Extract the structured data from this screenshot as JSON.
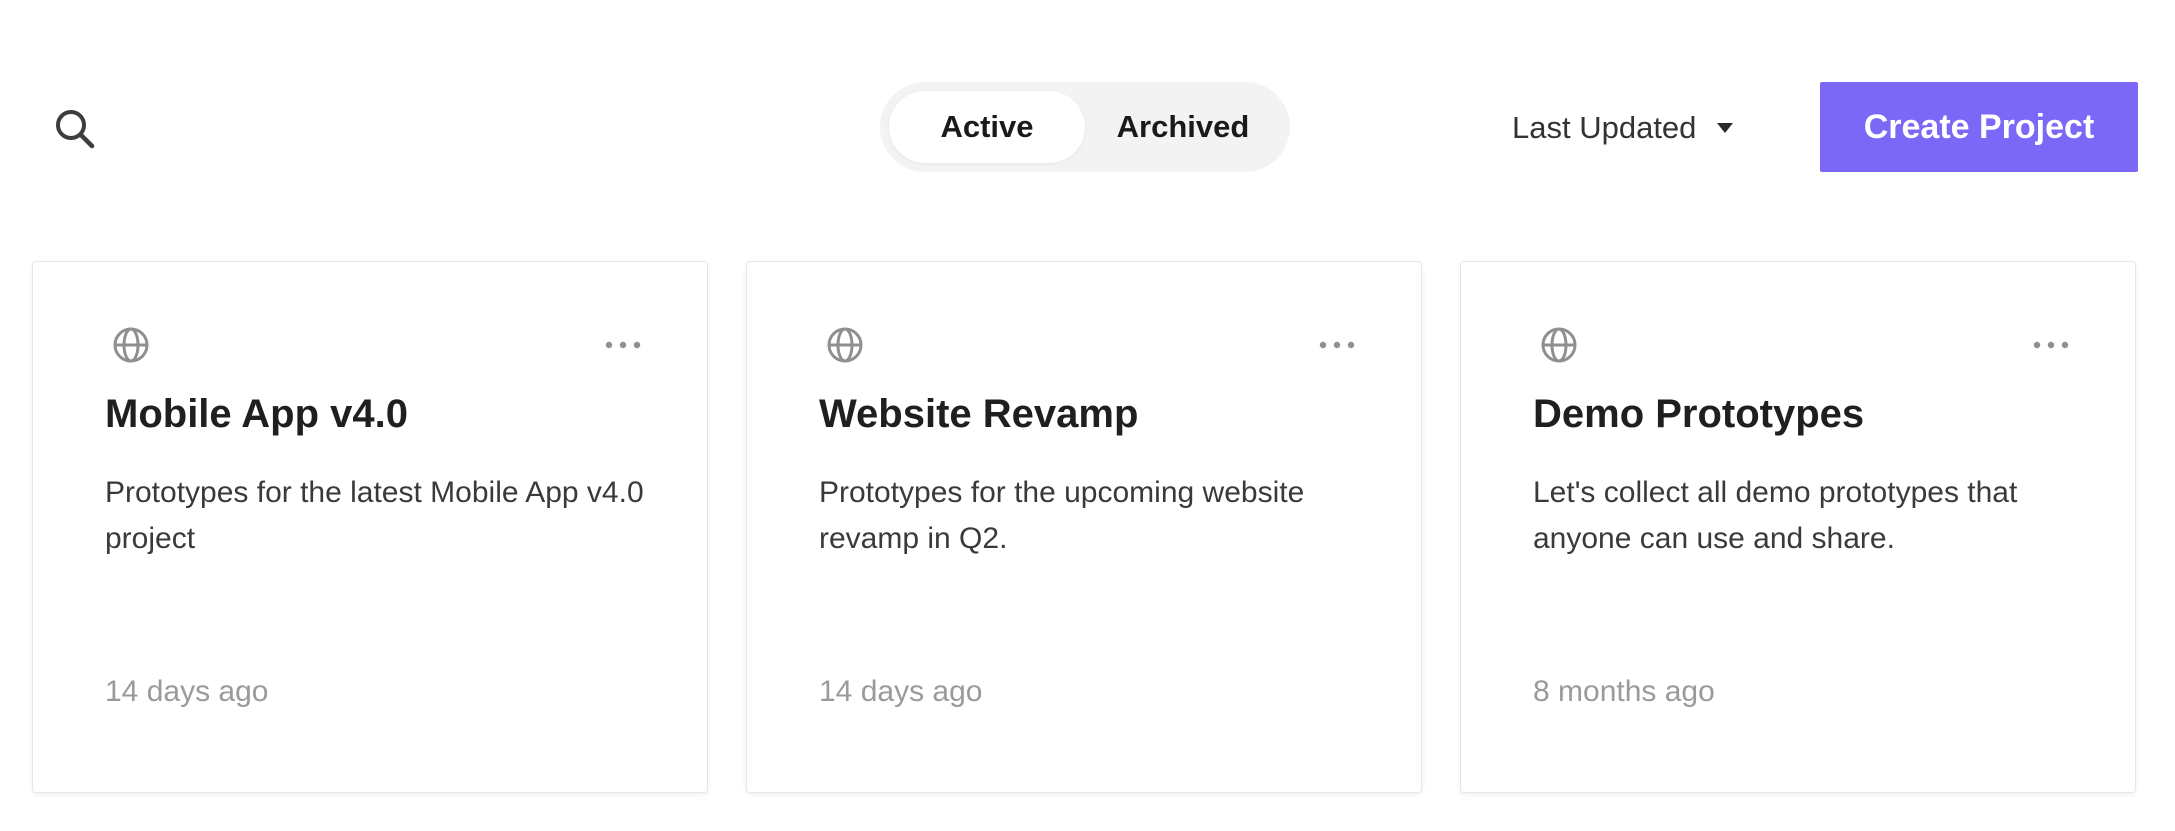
{
  "toolbar": {
    "search_icon": "search-icon",
    "tabs": [
      {
        "label": "Active",
        "selected": true
      },
      {
        "label": "Archived",
        "selected": false
      }
    ],
    "sort_label": "Last Updated",
    "sort_icon": "caret-down-icon",
    "create_label": "Create Project"
  },
  "colors": {
    "accent": "#7b68f6",
    "muted_text": "#9a9a9a",
    "icon": "#8f8f8f"
  },
  "projects": [
    {
      "icon": "globe-icon",
      "title": "Mobile App v4.0",
      "description": "Prototypes for the latest Mobile App v4.0 project",
      "updated": "14 days ago"
    },
    {
      "icon": "globe-icon",
      "title": "Website Revamp",
      "description": "Prototypes for the upcoming website revamp in Q2.",
      "updated": "14 days ago"
    },
    {
      "icon": "globe-icon",
      "title": "Demo Prototypes",
      "description": "Let's collect all demo prototypes that anyone can use and share.",
      "updated": "8 months ago"
    }
  ]
}
